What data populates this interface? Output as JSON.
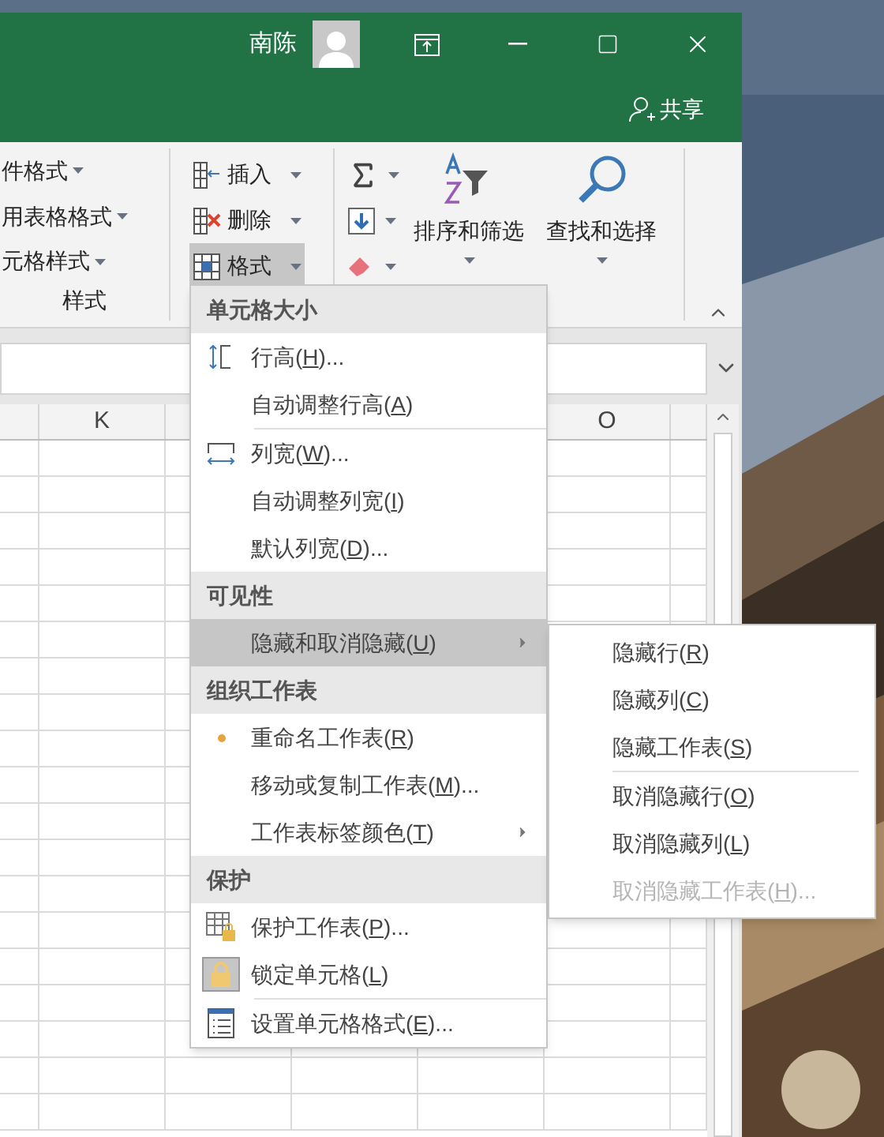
{
  "title_bar": {
    "user_name": "南陈",
    "share": "共享"
  },
  "ribbon": {
    "styles_group": {
      "items": [
        "件格式",
        "用表格格式",
        "元格样式"
      ],
      "label": "样式"
    },
    "cells_group": {
      "items": [
        {
          "label": "插入",
          "selected": false
        },
        {
          "label": "删除",
          "selected": false
        },
        {
          "label": "格式",
          "selected": true
        }
      ]
    },
    "editing_group": {
      "sort": "排序和筛选",
      "find": "查找和选择"
    }
  },
  "sheet": {
    "columns": [
      "K",
      "O"
    ]
  },
  "format_menu": {
    "sections": [
      {
        "title": "单元格大小",
        "items": [
          {
            "kind": "command",
            "before": "行高(",
            "key": "H",
            "after": ")...",
            "separator_before": false,
            "selected": false
          },
          {
            "kind": "command",
            "before": "自动调整行高(",
            "key": "A",
            "after": ")",
            "separator_before": false,
            "selected": false
          },
          {
            "kind": "command",
            "before": "列宽(",
            "key": "W",
            "after": ")...",
            "separator_before": true,
            "selected": false
          },
          {
            "kind": "command",
            "before": "自动调整列宽(",
            "key": "I",
            "after": ")",
            "separator_before": false,
            "selected": false
          },
          {
            "kind": "command",
            "before": "默认列宽(",
            "key": "D",
            "after": ")...",
            "separator_before": false,
            "selected": false
          }
        ]
      },
      {
        "title": "可见性",
        "items": [
          {
            "kind": "submenu",
            "before": "隐藏和取消隐藏(",
            "key": "U",
            "after": ")",
            "separator_before": false,
            "selected": true
          }
        ]
      },
      {
        "title": "组织工作表",
        "items": [
          {
            "kind": "command",
            "before": "重命名工作表(",
            "key": "R",
            "after": ")",
            "separator_before": false,
            "selected": false
          },
          {
            "kind": "command",
            "before": "移动或复制工作表(",
            "key": "M",
            "after": ")...",
            "separator_before": false,
            "selected": false
          },
          {
            "kind": "submenu",
            "before": "工作表标签颜色(",
            "key": "T",
            "after": ")",
            "separator_before": false,
            "selected": false
          }
        ]
      },
      {
        "title": "保护",
        "items": [
          {
            "kind": "command",
            "before": "保护工作表(",
            "key": "P",
            "after": ")...",
            "separator_before": false,
            "selected": false
          },
          {
            "kind": "toggle",
            "before": "锁定单元格(",
            "key": "L",
            "after": ")",
            "separator_before": false,
            "selected": false,
            "checked": true
          },
          {
            "kind": "command",
            "before": "设置单元格格式(",
            "key": "E",
            "after": ")...",
            "separator_before": true,
            "selected": false
          }
        ]
      }
    ]
  },
  "hide_submenu": {
    "items": [
      {
        "before": "隐藏行(",
        "key": "R",
        "after": ")",
        "separator_before": false,
        "disabled": false
      },
      {
        "before": "隐藏列(",
        "key": "C",
        "after": ")",
        "separator_before": false,
        "disabled": false
      },
      {
        "before": "隐藏工作表(",
        "key": "S",
        "after": ")",
        "separator_before": false,
        "disabled": false
      },
      {
        "before": "取消隐藏行(",
        "key": "O",
        "after": ")",
        "separator_before": true,
        "disabled": false
      },
      {
        "before": "取消隐藏列(",
        "key": "L",
        "after": ")",
        "separator_before": false,
        "disabled": false
      },
      {
        "before": "取消隐藏工作表(",
        "key": "H",
        "after": ")...",
        "separator_before": false,
        "disabled": true
      }
    ]
  }
}
